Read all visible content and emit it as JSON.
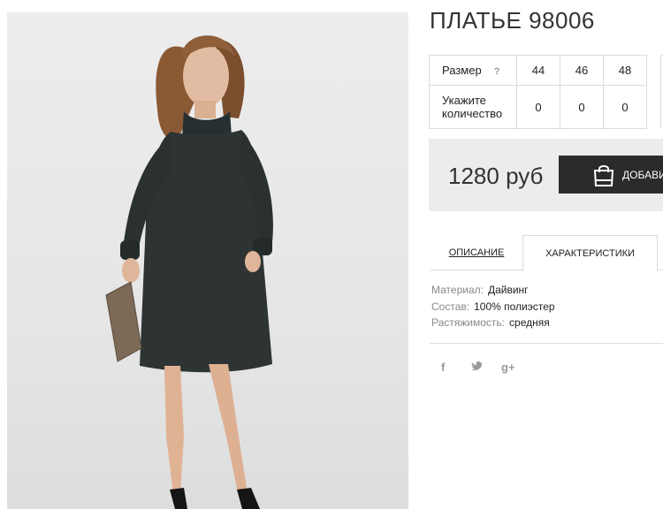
{
  "product": {
    "title": "ПЛАТЬЕ 98006",
    "photo_alt": "dress-photo"
  },
  "sizes": {
    "row_label": "Размер",
    "help": "?",
    "values": [
      "44",
      "46",
      "48"
    ],
    "qty_label": "Укажите количество",
    "quantities": [
      "0",
      "0",
      "0"
    ]
  },
  "buy": {
    "price": "1280 руб",
    "add_label": "ДОБАВИ"
  },
  "tabs": {
    "description": "Описание",
    "characteristics": "Характеристики"
  },
  "specs": [
    {
      "key": "Материал:",
      "value": "Дайвинг"
    },
    {
      "key": "Состав:",
      "value": "100% полиэстер"
    },
    {
      "key": "Растяжимость:",
      "value": "средняя"
    }
  ],
  "social": {
    "facebook": "f",
    "twitter": "t",
    "googleplus": "g+"
  },
  "colors": {
    "button_bg": "#2b2b2b",
    "buy_box_bg": "#ececec",
    "dress": "#2d3433",
    "border": "#dcdcdc"
  }
}
